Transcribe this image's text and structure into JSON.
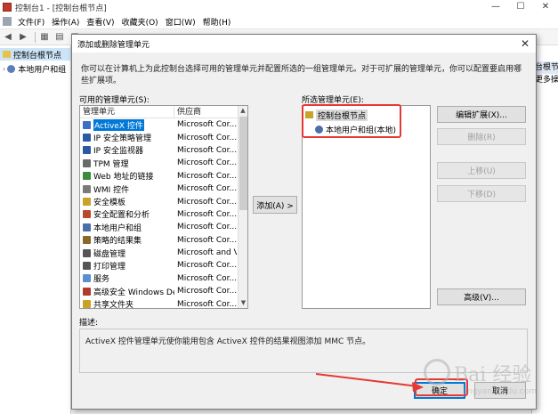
{
  "mmc": {
    "title": "控制台1 - [控制台根节点]",
    "window_buttons": [
      "—",
      "☐",
      "✕"
    ],
    "menu": [
      "文件(F)",
      "操作(A)",
      "查看(V)",
      "收藏夹(O)",
      "窗口(W)",
      "帮助(H)"
    ],
    "tree_root": "控制台根节点",
    "tree_child": "本地用户和组",
    "actions_header": "台根节点",
    "actions_more": "更多操作"
  },
  "dialog": {
    "title": "添加或删除管理单元",
    "close": "✕",
    "description": "你可以在计算机上为此控制台选择可用的管理单元并配置所选的一组管理单元。对于可扩展的管理单元，你可以配置要启用哪些扩展项。",
    "available_label": "可用的管理单元(S):",
    "selected_label": "所选管理单元(E):",
    "columns": [
      "管理单元",
      "供应商"
    ],
    "snapins": [
      {
        "name": "ActiveX 控件",
        "vendor": "Microsoft Cor...",
        "icon_color": "#3a6fc4",
        "selected": true
      },
      {
        "name": "IP 安全策略管理",
        "vendor": "Microsoft Cor...",
        "icon_color": "#2b5aa3"
      },
      {
        "name": "IP 安全监视器",
        "vendor": "Microsoft Cor...",
        "icon_color": "#2b5aa3"
      },
      {
        "name": "TPM 管理",
        "vendor": "Microsoft Cor...",
        "icon_color": "#6a6a6a"
      },
      {
        "name": "Web 地址的链接",
        "vendor": "Microsoft Cor...",
        "icon_color": "#3d8b3d"
      },
      {
        "name": "WMI 控件",
        "vendor": "Microsoft Cor...",
        "icon_color": "#7a7a7a"
      },
      {
        "name": "安全模板",
        "vendor": "Microsoft Cor...",
        "icon_color": "#c9a227"
      },
      {
        "name": "安全配置和分析",
        "vendor": "Microsoft Cor...",
        "icon_color": "#b84a2a"
      },
      {
        "name": "本地用户和组",
        "vendor": "Microsoft Cor...",
        "icon_color": "#4a6fa8"
      },
      {
        "name": "策略的结果集",
        "vendor": "Microsoft Cor...",
        "icon_color": "#8a6a2a"
      },
      {
        "name": "磁盘管理",
        "vendor": "Microsoft and V...",
        "icon_color": "#555555"
      },
      {
        "name": "打印管理",
        "vendor": "Microsoft Cor...",
        "icon_color": "#555555"
      },
      {
        "name": "服务",
        "vendor": "Microsoft Cor...",
        "icon_color": "#5a8fd0"
      },
      {
        "name": "高级安全 Windows De...",
        "vendor": "Microsoft Cor...",
        "icon_color": "#b03a2e"
      },
      {
        "name": "共享文件夹",
        "vendor": "Microsoft Cor...",
        "icon_color": "#c9a227"
      }
    ],
    "add_button": "添加(A) >",
    "selected_root": "控制台根节点",
    "selected_child": "本地用户和组(本地)",
    "buttons": {
      "edit_extensions": "编辑扩展(X)...",
      "remove": "删除(R)",
      "move_up": "上移(U)",
      "move_down": "下移(D)",
      "advanced": "高级(V)...",
      "ok": "确定",
      "cancel": "取消"
    },
    "desc_label": "描述:",
    "desc_text": "ActiveX 控件管理单元使你能用包含 ActiveX 控件的结果视图添加 MMC 节点。"
  },
  "watermark": {
    "text": "Bai 经验",
    "sub": "jingyan.baidu.com"
  },
  "colors": {
    "annotation_red": "#e53935",
    "selection_blue": "#0078d7"
  }
}
